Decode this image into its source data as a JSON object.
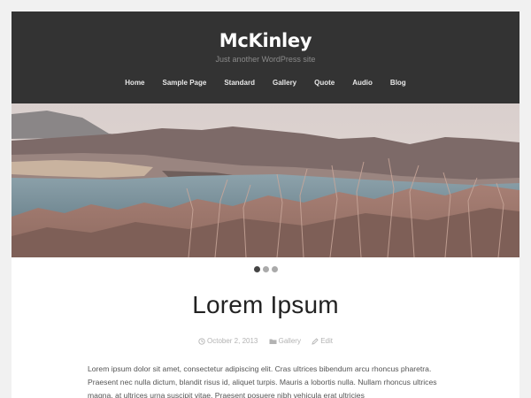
{
  "site": {
    "title": "McKinley",
    "description": "Just another WordPress site"
  },
  "nav": {
    "items": [
      "Home",
      "Sample Page",
      "Standard",
      "Gallery",
      "Quote",
      "Audio",
      "Blog"
    ]
  },
  "slider": {
    "slide_count": 3,
    "active_index": 0
  },
  "post": {
    "title": "Lorem Ipsum",
    "date": "October 2, 2013",
    "category": "Gallery",
    "edit_label": "Edit",
    "excerpt": "Lorem ipsum dolor sit amet, consectetur adipiscing elit. Cras ultrices bibendum arcu rhoncus pharetra. Praesent nec nulla dictum, blandit risus id, aliquet turpis. Mauris a lobortis nulla. Nullam rhoncus ultrices magna, at ultrices urna suscipit vitae. Praesent posuere nibh vehicula erat ultricies"
  },
  "colors": {
    "header_bg": "#333333",
    "page_bg": "#f1f1f1",
    "content_bg": "#ffffff",
    "dot_active": "#444444",
    "dot_inactive": "#aaaaaa"
  }
}
